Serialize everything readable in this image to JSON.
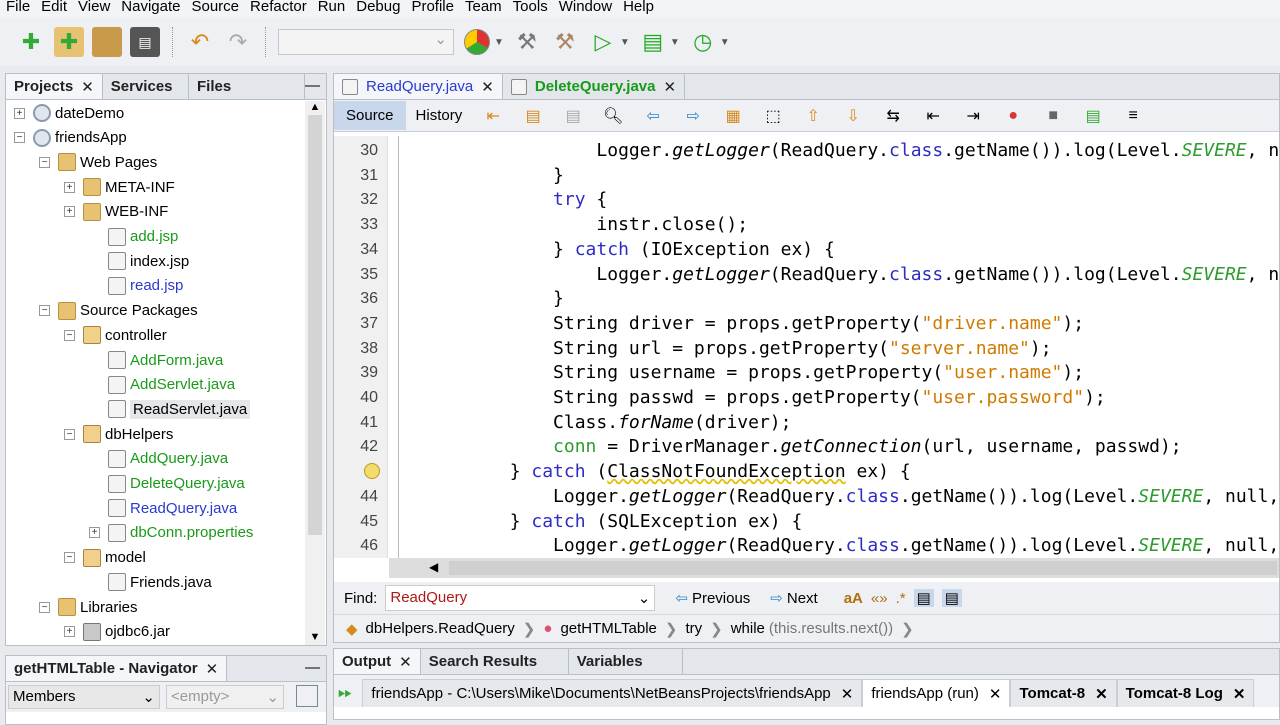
{
  "menu": [
    "File",
    "Edit",
    "View",
    "Navigate",
    "Source",
    "Refactor",
    "Run",
    "Debug",
    "Profile",
    "Team",
    "Tools",
    "Window",
    "Help"
  ],
  "toolbar": {
    "config_value": "",
    "icons": [
      "new-file-icon",
      "new-project-icon",
      "open-project-icon",
      "save-all-icon",
      "undo-icon",
      "redo-icon",
      "chrome-browser-icon",
      "build-hammer-icon",
      "clean-build-icon",
      "run-icon",
      "debug-icon",
      "profile-icon"
    ]
  },
  "projects": {
    "tabs": [
      "Projects",
      "Services",
      "Files"
    ],
    "tree": [
      {
        "label": "dateDemo",
        "level": 0,
        "exp": "+",
        "icon": "globe",
        "color": "black"
      },
      {
        "label": "friendsApp",
        "level": 0,
        "exp": "-",
        "icon": "globe",
        "color": "black"
      },
      {
        "label": "Web Pages",
        "level": 1,
        "exp": "-",
        "icon": "folder",
        "color": "black"
      },
      {
        "label": "META-INF",
        "level": 2,
        "exp": "+",
        "icon": "folder",
        "color": "black"
      },
      {
        "label": "WEB-INF",
        "level": 2,
        "exp": "+",
        "icon": "folder",
        "color": "black"
      },
      {
        "label": "add.jsp",
        "level": 3,
        "exp": "",
        "icon": "file",
        "color": "green"
      },
      {
        "label": "index.jsp",
        "level": 3,
        "exp": "",
        "icon": "file",
        "color": "black"
      },
      {
        "label": "read.jsp",
        "level": 3,
        "exp": "",
        "icon": "file",
        "color": "blue"
      },
      {
        "label": "Source Packages",
        "level": 1,
        "exp": "-",
        "icon": "folder",
        "color": "black"
      },
      {
        "label": "controller",
        "level": 2,
        "exp": "-",
        "icon": "pkg",
        "color": "black"
      },
      {
        "label": "AddForm.java",
        "level": 3,
        "exp": "",
        "icon": "file",
        "color": "green"
      },
      {
        "label": "AddServlet.java",
        "level": 3,
        "exp": "",
        "icon": "file",
        "color": "green"
      },
      {
        "label": "ReadServlet.java",
        "level": 3,
        "exp": "",
        "icon": "file",
        "color": "black",
        "selected": true
      },
      {
        "label": "dbHelpers",
        "level": 2,
        "exp": "-",
        "icon": "pkg",
        "color": "black"
      },
      {
        "label": "AddQuery.java",
        "level": 3,
        "exp": "",
        "icon": "file",
        "color": "green"
      },
      {
        "label": "DeleteQuery.java",
        "level": 3,
        "exp": "",
        "icon": "file",
        "color": "green"
      },
      {
        "label": "ReadQuery.java",
        "level": 3,
        "exp": "",
        "icon": "file",
        "color": "blue"
      },
      {
        "label": "dbConn.properties",
        "level": 3,
        "exp": "+",
        "icon": "file",
        "color": "green"
      },
      {
        "label": "model",
        "level": 2,
        "exp": "-",
        "icon": "pkg",
        "color": "black"
      },
      {
        "label": "Friends.java",
        "level": 3,
        "exp": "",
        "icon": "file",
        "color": "black"
      },
      {
        "label": "Libraries",
        "level": 1,
        "exp": "-",
        "icon": "folder",
        "color": "black"
      },
      {
        "label": "ojdbc6.jar",
        "level": 2,
        "exp": "+",
        "icon": "jar",
        "color": "black"
      }
    ]
  },
  "navigator": {
    "title": "getHTMLTable - Navigator",
    "members": "Members",
    "filter": "<empty>"
  },
  "editor": {
    "tabs": [
      {
        "label": "ReadQuery.java",
        "color": "blue",
        "active": true
      },
      {
        "label": "DeleteQuery.java",
        "color": "green",
        "active": false
      }
    ],
    "source_tab": "Source",
    "history_tab": "History",
    "lines": [
      {
        "n": "30",
        "s": [
          [
            "                Logger.",
            ""
          ],
          [
            "getLogger",
            "it"
          ],
          [
            "(ReadQuery.",
            ""
          ],
          [
            "class",
            "cls"
          ],
          [
            ".getName()).log(Level.",
            ""
          ],
          [
            "SEVERE",
            "fld"
          ],
          [
            ", null, ex);",
            ""
          ]
        ]
      },
      {
        "n": "31",
        "s": [
          [
            "            }",
            ""
          ]
        ]
      },
      {
        "n": "32",
        "s": [
          [
            "            ",
            ""
          ],
          [
            "try",
            "kw"
          ],
          [
            " {",
            ""
          ]
        ]
      },
      {
        "n": "33",
        "s": [
          [
            "                instr.close();",
            ""
          ]
        ]
      },
      {
        "n": "34",
        "s": [
          [
            "            } ",
            ""
          ],
          [
            "catch",
            "kw"
          ],
          [
            " (IOException ex) {",
            ""
          ]
        ]
      },
      {
        "n": "35",
        "s": [
          [
            "                Logger.",
            ""
          ],
          [
            "getLogger",
            "it"
          ],
          [
            "(ReadQuery.",
            ""
          ],
          [
            "class",
            "cls"
          ],
          [
            ".getName()).log(Level.",
            ""
          ],
          [
            "SEVERE",
            "fld"
          ],
          [
            ", null, ex);",
            ""
          ]
        ]
      },
      {
        "n": "36",
        "s": [
          [
            "            }",
            ""
          ]
        ]
      },
      {
        "n": "37",
        "s": [
          [
            "            String driver = props.getProperty(",
            ""
          ],
          [
            "\"driver.name\"",
            "str"
          ],
          [
            ");",
            ""
          ]
        ]
      },
      {
        "n": "38",
        "s": [
          [
            "            String url = props.getProperty(",
            ""
          ],
          [
            "\"server.name\"",
            "str"
          ],
          [
            ");",
            ""
          ]
        ]
      },
      {
        "n": "39",
        "s": [
          [
            "            String username = props.getProperty(",
            ""
          ],
          [
            "\"user.name\"",
            "str"
          ],
          [
            ");",
            ""
          ]
        ]
      },
      {
        "n": "40",
        "s": [
          [
            "            String passwd = props.getProperty(",
            ""
          ],
          [
            "\"user.password\"",
            "str"
          ],
          [
            ");",
            ""
          ]
        ]
      },
      {
        "n": "41",
        "s": [
          [
            "            Class.",
            ""
          ],
          [
            "forName",
            "it"
          ],
          [
            "(driver);",
            ""
          ]
        ]
      },
      {
        "n": "42",
        "s": [
          [
            "            ",
            ""
          ],
          [
            "conn",
            "var"
          ],
          [
            " = DriverManager.",
            ""
          ],
          [
            "getConnection",
            "it"
          ],
          [
            "(url, username, passwd);",
            ""
          ]
        ]
      },
      {
        "n": "",
        "warn": true,
        "s": [
          [
            "        } ",
            ""
          ],
          [
            "catch",
            "kw"
          ],
          [
            " (",
            ""
          ],
          [
            "ClassNotFoundException",
            "warn"
          ],
          [
            " ex) {",
            ""
          ]
        ]
      },
      {
        "n": "44",
        "s": [
          [
            "            Logger.",
            ""
          ],
          [
            "getLogger",
            "it"
          ],
          [
            "(ReadQuery.",
            ""
          ],
          [
            "class",
            "cls"
          ],
          [
            ".getName()).log(Level.",
            ""
          ],
          [
            "SEVERE",
            "fld"
          ],
          [
            ", null, ex);",
            ""
          ]
        ]
      },
      {
        "n": "45",
        "s": [
          [
            "        } ",
            ""
          ],
          [
            "catch",
            "kw"
          ],
          [
            " (SQLException ex) {",
            ""
          ]
        ]
      },
      {
        "n": "46",
        "s": [
          [
            "            Logger.",
            ""
          ],
          [
            "getLogger",
            "it"
          ],
          [
            "(ReadQuery.",
            ""
          ],
          [
            "class",
            "cls"
          ],
          [
            ".getName()).log(Level.",
            ""
          ],
          [
            "SEVERE",
            "fld"
          ],
          [
            ", null, ex);",
            ""
          ]
        ]
      }
    ]
  },
  "find": {
    "label": "Find:",
    "value": "ReadQuery",
    "previous": "Previous",
    "next": "Next"
  },
  "breadcrumb": [
    "dbHelpers.ReadQuery",
    "getHTMLTable",
    "try",
    "while"
  ],
  "breadcrumb_cond": "(this.results.next())",
  "output": {
    "tabs": [
      "Output",
      "Search Results",
      "Variables"
    ],
    "subtabs": [
      {
        "label": "friendsApp - C:\\Users\\Mike\\Documents\\NetBeansProjects\\friendsApp",
        "bold": false
      },
      {
        "label": "friendsApp (run)",
        "bold": false,
        "active": true
      },
      {
        "label": "Tomcat-8",
        "bold": true
      },
      {
        "label": "Tomcat-8 Log",
        "bold": true
      }
    ]
  }
}
